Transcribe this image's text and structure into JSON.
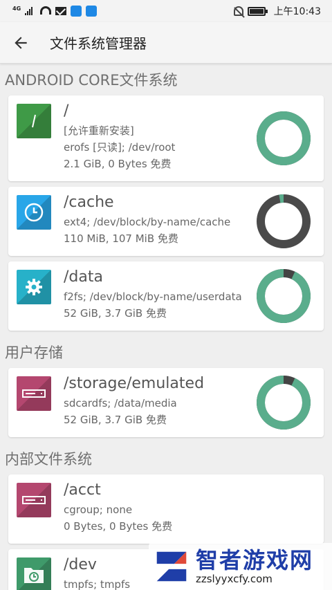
{
  "status_bar": {
    "network": "4G",
    "time": "上午10:43"
  },
  "app_bar": {
    "title": "文件系统管理器",
    "back_icon": "arrow-left-icon"
  },
  "sections": [
    {
      "title": "ANDROID CORE文件系统",
      "items": [
        {
          "path": "/",
          "lines": [
            "[允许重新安装]",
            "erofs [只读]; /dev/root",
            "2.1 GiB, 0 Bytes 免费"
          ],
          "icon": "slash-icon",
          "icon_color": "#3f9a47",
          "used_fraction": 1.0,
          "ring_color": "#5aad8c",
          "ring_bg": "#444444"
        },
        {
          "path": "/cache",
          "lines": [
            "ext4; /dev/block/by-name/cache",
            "110 MiB, 107 MiB 免费"
          ],
          "icon": "clock-icon",
          "icon_color": "#29a6e8",
          "used_fraction": 0.027,
          "ring_color": "#5aad8c",
          "ring_bg": "#4a4a4a"
        },
        {
          "path": "/data",
          "lines": [
            "f2fs; /dev/block/by-name/userdata",
            "52 GiB, 3.7 GiB 免费"
          ],
          "icon": "gear-icon",
          "icon_color": "#27b1c9",
          "used_fraction": 0.929,
          "ring_color": "#5aad8c",
          "ring_bg": "#444444"
        }
      ]
    },
    {
      "title": "用户存储",
      "items": [
        {
          "path": "/storage/emulated",
          "lines": [
            "sdcardfs; /data/media",
            "52 GiB, 3.7 GiB 免费"
          ],
          "icon": "drive-icon",
          "icon_color": "#b4476f",
          "used_fraction": 0.929,
          "ring_color": "#5aad8c",
          "ring_bg": "#444444"
        }
      ]
    },
    {
      "title": "内部文件系统",
      "items": [
        {
          "path": "/acct",
          "lines": [
            "cgroup; none",
            "0 Bytes, 0 Bytes 免费"
          ],
          "icon": "drive-icon",
          "icon_color": "#b4476f",
          "used_fraction": null
        },
        {
          "path": "/dev",
          "lines": [
            "tmpfs; tmpfs"
          ],
          "icon": "folder-clock-icon",
          "icon_color": "#3f9a6a",
          "used_fraction": null
        }
      ]
    }
  ],
  "watermark": {
    "title": "智者游戏网",
    "url": "zzslyyxcfy.com",
    "logo_icon": "z-logo-icon"
  }
}
